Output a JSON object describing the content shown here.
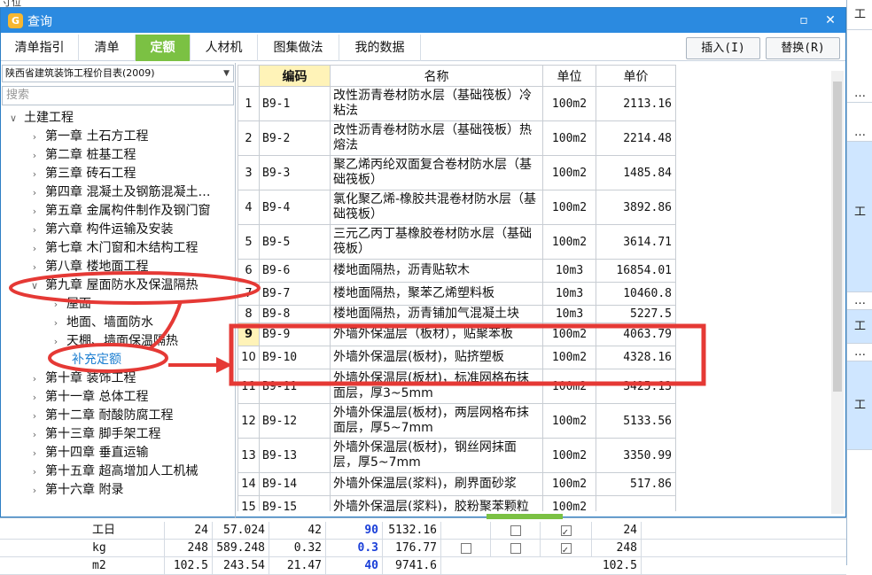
{
  "bg": {
    "top_text": "寸位",
    "right_col": [
      "工",
      "…",
      "…",
      "工",
      "…",
      "工",
      "…",
      "工"
    ],
    "bottom_rows": [
      {
        "unit": "工日",
        "a": "24",
        "b": "57.024",
        "c": "42",
        "d": "90",
        "e": "5132.16",
        "f": "24"
      },
      {
        "unit": "kg",
        "a": "248",
        "b": "589.248",
        "c": "0.32",
        "d": "0.3",
        "e": "176.77",
        "f": "248"
      },
      {
        "unit": "m2",
        "a": "102.5",
        "b": "243.54",
        "c": "21.47",
        "d": "40",
        "e": "9741.6",
        "f": "102.5"
      }
    ]
  },
  "dialog": {
    "title": "查询",
    "tabs": [
      "清单指引",
      "清单",
      "定额",
      "人材机",
      "图集做法",
      "我的数据"
    ],
    "insert_label": "插入(I)",
    "replace_label": "替换(R)",
    "library": "陕西省建筑装饰工程价目表(2009)",
    "search_placeholder": "搜索",
    "tree": {
      "root": "土建工程",
      "chapters_before": [
        "第一章  土石方工程",
        "第二章  桩基工程",
        "第三章  砖石工程",
        "第四章  混凝土及钢筋混凝土…",
        "第五章  金属构件制作及钢门窗",
        "第六章  构件运输及安装",
        "第七章  木门窗和木结构工程",
        "第八章  楼地面工程"
      ],
      "open_chapter": "第九章  屋面防水及保温隔热",
      "subs": [
        "屋面",
        "地面、墙面防水",
        "天棚、墙面保温隔热"
      ],
      "supplement": "补充定额",
      "chapters_after": [
        "第十章  装饰工程",
        "第十一章  总体工程",
        "第十二章  耐酸防腐工程",
        "第十三章  脚手架工程",
        "第十四章  垂直运输",
        "第十五章  超高增加人工机械",
        "第十六章  附录"
      ]
    },
    "table": {
      "headers": [
        "编码",
        "名称",
        "单位",
        "单价"
      ],
      "rows": [
        {
          "n": "1",
          "code": "B9-1",
          "name": "改性沥青卷材防水层（基础筏板）冷粘法",
          "unit": "100m2",
          "price": "2113.16"
        },
        {
          "n": "2",
          "code": "B9-2",
          "name": "改性沥青卷材防水层（基础筏板）热熔法",
          "unit": "100m2",
          "price": "2214.48"
        },
        {
          "n": "3",
          "code": "B9-3",
          "name": "聚乙烯丙纶双面复合卷材防水层（基础筏板）",
          "unit": "100m2",
          "price": "1485.84"
        },
        {
          "n": "4",
          "code": "B9-4",
          "name": "氯化聚乙烯-橡胶共混卷材防水层（基础筏板）",
          "unit": "100m2",
          "price": "3892.86"
        },
        {
          "n": "5",
          "code": "B9-5",
          "name": "三元乙丙丁基橡胶卷材防水层（基础筏板）",
          "unit": "100m2",
          "price": "3614.71"
        },
        {
          "n": "6",
          "code": "B9-6",
          "name": "楼地面隔热，沥青贴软木",
          "unit": "10m3",
          "price": "16854.01"
        },
        {
          "n": "7",
          "code": "B9-7",
          "name": "楼地面隔热，聚苯乙烯塑料板",
          "unit": "10m3",
          "price": "10460.8"
        },
        {
          "n": "8",
          "code": "B9-8",
          "name": "楼地面隔热，沥青铺加气混凝土块",
          "unit": "10m3",
          "price": "5227.5"
        },
        {
          "n": "9",
          "code": "B9-9",
          "name": "外墙外保温层（板材），贴聚苯板",
          "unit": "100m2",
          "price": "4063.79"
        },
        {
          "n": "10",
          "code": "B9-10",
          "name": "外墙外保温层(板材)，贴挤塑板",
          "unit": "100m2",
          "price": "4328.16"
        },
        {
          "n": "11",
          "code": "B9-11",
          "name": "外墙外保温层(板材)，标准网格布抹面层，厚3~5mm",
          "unit": "100m2",
          "price": "3425.13"
        },
        {
          "n": "12",
          "code": "B9-12",
          "name": "外墙外保温层(板材)，两层网格布抹面层，厚5~7mm",
          "unit": "100m2",
          "price": "5133.56"
        },
        {
          "n": "13",
          "code": "B9-13",
          "name": "外墙外保温层(板材)，钢丝网抹面层，厚5~7mm",
          "unit": "100m2",
          "price": "3350.99"
        },
        {
          "n": "14",
          "code": "B9-14",
          "name": "外墙外保温层(浆料)，刷界面砂浆",
          "unit": "100m2",
          "price": "517.86"
        },
        {
          "n": "15",
          "code": "B9-15",
          "name": "外墙外保温层(浆料)，胶粉聚苯颗粒",
          "unit": "100m2",
          "price": ""
        }
      ]
    }
  },
  "colors": {
    "title_bar": "#2b8ae0",
    "active_tab": "#7bc143",
    "annotation": "#e53935",
    "highlight": "#fff3b8"
  }
}
